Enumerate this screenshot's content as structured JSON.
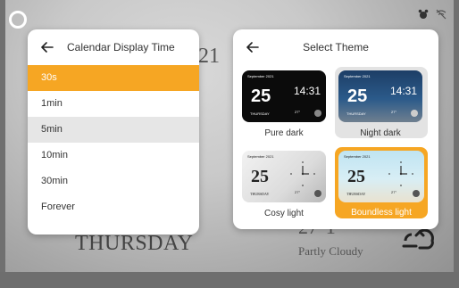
{
  "background": {
    "date_number": "21",
    "day_name": "THURSDAY",
    "temperature": "27°1",
    "weather": "Partly Cloudy"
  },
  "calendar_panel": {
    "title": "Calendar Display Time",
    "options": [
      "30s",
      "1min",
      "5min",
      "10min",
      "30min",
      "Forever"
    ],
    "selected": "30s",
    "highlighted": "5min"
  },
  "theme_panel": {
    "title": "Select Theme",
    "themes": [
      {
        "label": "Pure dark",
        "month": "September 2021",
        "day_number": "25",
        "day_name": "THURSDAY",
        "time": "14:31",
        "temp": "27°"
      },
      {
        "label": "Night dark",
        "month": "September 2021",
        "day_number": "25",
        "day_name": "THURSDAY",
        "time": "14:31",
        "temp": "27°"
      },
      {
        "label": "Cosy light",
        "month": "September 2021",
        "day_number": "25",
        "day_name": "THURSDAY",
        "temp": "27°"
      },
      {
        "label": "Boundless light",
        "month": "September 2021",
        "day_number": "25",
        "day_name": "THURSDAY",
        "temp": "27°"
      }
    ],
    "selected": "Boundless light",
    "highlighted": "Night dark"
  },
  "colors": {
    "accent": "#f6a623",
    "panel_bg": "#ffffff",
    "highlight": "#e6e6e6"
  },
  "icons": {
    "back": "arrow-left-icon",
    "status_alarm": "alarm-icon",
    "status_wifi": "wifi-off-icon",
    "weather": "cloud-sun-icon"
  }
}
